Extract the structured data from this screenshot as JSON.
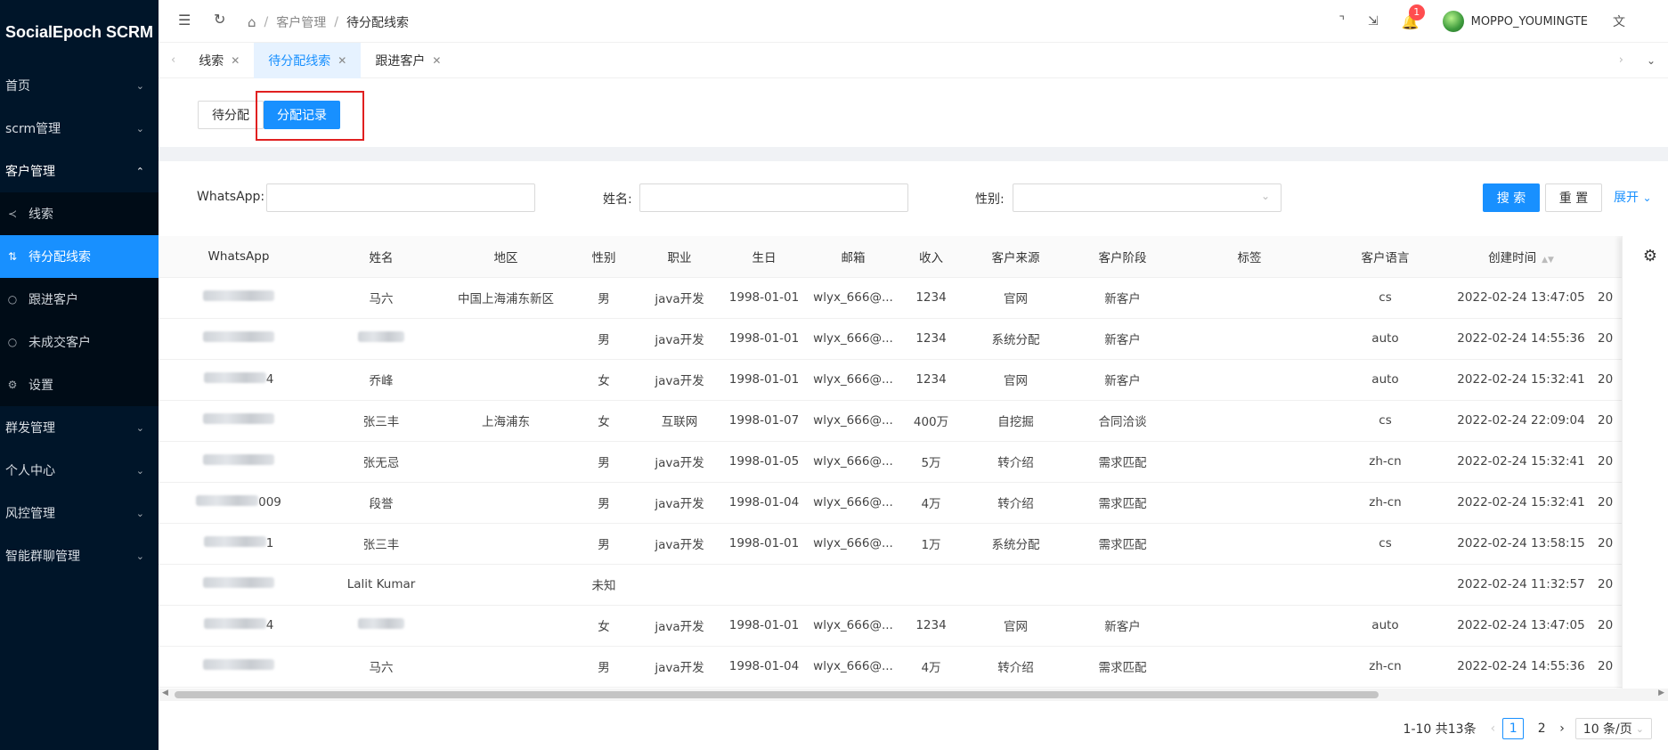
{
  "app": {
    "title": "SocialEpoch SCRM"
  },
  "sidebar": {
    "items": [
      {
        "label": "首页"
      },
      {
        "label": "scrm管理"
      },
      {
        "label": "客户管理"
      },
      {
        "label": "群发管理"
      },
      {
        "label": "个人中心"
      },
      {
        "label": "风控管理"
      },
      {
        "label": "智能群聊管理"
      }
    ],
    "sub_items": [
      {
        "label": "线索",
        "icon": "share-icon"
      },
      {
        "label": "待分配线索",
        "icon": "sort-icon"
      },
      {
        "label": "跟进客户",
        "icon": "user-icon"
      },
      {
        "label": "未成交客户",
        "icon": "user-icon"
      },
      {
        "label": "设置",
        "icon": "gear-icon"
      }
    ]
  },
  "header": {
    "breadcrumb": {
      "parent": "客户管理",
      "current": "待分配线索",
      "sep": "/"
    },
    "notification_count": "1",
    "username": "MOPPO_YOUMINGTE"
  },
  "tabs": [
    {
      "label": "线索"
    },
    {
      "label": "待分配线索"
    },
    {
      "label": "跟进客户"
    }
  ],
  "toggle": {
    "pending": "待分配",
    "records": "分配记录"
  },
  "search": {
    "whatsapp_label": "WhatsApp:",
    "name_label": "姓名:",
    "gender_label": "性别:",
    "search_btn": "搜 索",
    "reset_btn": "重 置",
    "expand": "展开"
  },
  "table": {
    "headers": [
      "WhatsApp",
      "姓名",
      "地区",
      "性别",
      "职业",
      "生日",
      "邮箱",
      "收入",
      "客户来源",
      "客户阶段",
      "标签",
      "客户语言",
      "创建时间"
    ],
    "rows": [
      {
        "whatsapp": "",
        "name": "马六",
        "region": "中国上海浦东新区",
        "gender": "男",
        "job": "java开发",
        "birthday": "1998-01-01",
        "email": "wlyx_666@...",
        "income": "1234",
        "source": "官网",
        "stage": "新客户",
        "tag": "",
        "lang": "cs",
        "created": "2022-02-24 13:47:05",
        "extra": "20"
      },
      {
        "whatsapp": "",
        "name": "",
        "region": "",
        "gender": "男",
        "job": "java开发",
        "birthday": "1998-01-01",
        "email": "wlyx_666@...",
        "income": "1234",
        "source": "系统分配",
        "stage": "新客户",
        "tag": "",
        "lang": "auto",
        "created": "2022-02-24 14:55:36",
        "extra": "20"
      },
      {
        "whatsapp": "4",
        "name": "乔峰",
        "region": "",
        "gender": "女",
        "job": "java开发",
        "birthday": "1998-01-01",
        "email": "wlyx_666@...",
        "income": "1234",
        "source": "官网",
        "stage": "新客户",
        "tag": "",
        "lang": "auto",
        "created": "2022-02-24 15:32:41",
        "extra": "20"
      },
      {
        "whatsapp": "",
        "name": "张三丰",
        "region": "上海浦东",
        "gender": "女",
        "job": "互联网",
        "birthday": "1998-01-07",
        "email": "wlyx_666@...",
        "income": "400万",
        "source": "自挖掘",
        "stage": "合同洽谈",
        "tag": "",
        "lang": "cs",
        "created": "2022-02-24 22:09:04",
        "extra": "20"
      },
      {
        "whatsapp": "",
        "name": "张无忌",
        "region": "",
        "gender": "男",
        "job": "java开发",
        "birthday": "1998-01-05",
        "email": "wlyx_666@...",
        "income": "5万",
        "source": "转介绍",
        "stage": "需求匹配",
        "tag": "",
        "lang": "zh-cn",
        "created": "2022-02-24 15:32:41",
        "extra": "20"
      },
      {
        "whatsapp": "009",
        "name": "段誉",
        "region": "",
        "gender": "男",
        "job": "java开发",
        "birthday": "1998-01-04",
        "email": "wlyx_666@...",
        "income": "4万",
        "source": "转介绍",
        "stage": "需求匹配",
        "tag": "",
        "lang": "zh-cn",
        "created": "2022-02-24 15:32:41",
        "extra": "20"
      },
      {
        "whatsapp": "1",
        "name": "张三丰",
        "region": "",
        "gender": "男",
        "job": "java开发",
        "birthday": "1998-01-01",
        "email": "wlyx_666@...",
        "income": "1万",
        "source": "系统分配",
        "stage": "需求匹配",
        "tag": "",
        "lang": "cs",
        "created": "2022-02-24 13:58:15",
        "extra": "20"
      },
      {
        "whatsapp": "",
        "name": "Lalit Kumar",
        "region": "",
        "gender": "未知",
        "job": "",
        "birthday": "",
        "email": "",
        "income": "",
        "source": "",
        "stage": "",
        "tag": "",
        "lang": "",
        "created": "2022-02-24 11:32:57",
        "extra": "20"
      },
      {
        "whatsapp": "4",
        "name": "",
        "region": "",
        "gender": "女",
        "job": "java开发",
        "birthday": "1998-01-01",
        "email": "wlyx_666@...",
        "income": "1234",
        "source": "官网",
        "stage": "新客户",
        "tag": "",
        "lang": "auto",
        "created": "2022-02-24 13:47:05",
        "extra": "20"
      },
      {
        "whatsapp": "",
        "name": "马六",
        "region": "",
        "gender": "男",
        "job": "java开发",
        "birthday": "1998-01-04",
        "email": "wlyx_666@...",
        "income": "4万",
        "source": "转介绍",
        "stage": "需求匹配",
        "tag": "",
        "lang": "zh-cn",
        "created": "2022-02-24 14:55:36",
        "extra": "20"
      }
    ]
  },
  "pagination": {
    "summary": "1-10 共13条",
    "pages": [
      "1",
      "2"
    ],
    "page_size": "10 条/页"
  },
  "colors": {
    "primary": "#1890ff",
    "sidebar": "#001529",
    "highlight_box": "#e02020"
  }
}
